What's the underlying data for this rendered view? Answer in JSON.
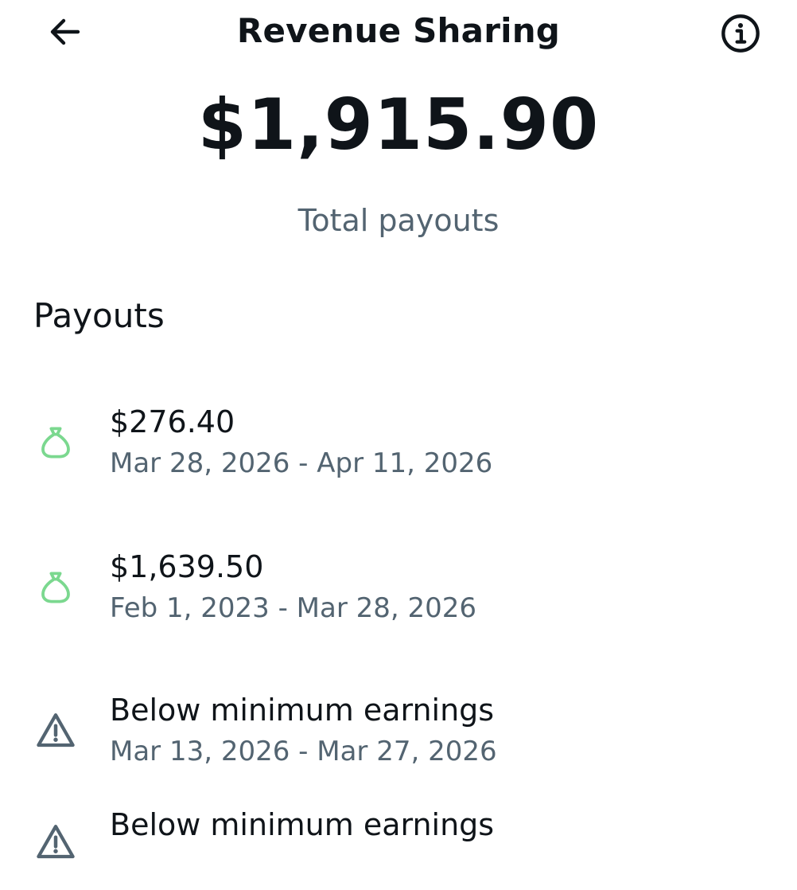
{
  "header": {
    "title": "Revenue Sharing",
    "back_icon": "arrow-left-icon",
    "info_icon": "info-icon"
  },
  "summary": {
    "amount": "$1,915.90",
    "label": "Total payouts"
  },
  "payouts": {
    "heading": "Payouts",
    "items": [
      {
        "title": "$276.40",
        "dates": "Mar 28, 2026 - Apr 11, 2026",
        "icon": "money-bag-icon",
        "icon_color": "#7bd88f"
      },
      {
        "title": "$1,639.50",
        "dates": "Feb 1, 2023 - Mar 28, 2026",
        "icon": "money-bag-icon",
        "icon_color": "#7bd88f"
      },
      {
        "title": "Below minimum earnings",
        "dates": "Mar 13, 2026 - Mar 27, 2026",
        "icon": "warning-icon",
        "icon_color": "#536471"
      },
      {
        "title": "Below minimum earnings",
        "dates": "",
        "icon": "warning-icon",
        "icon_color": "#536471"
      }
    ]
  },
  "colors": {
    "text_primary": "#0f1419",
    "text_secondary": "#536471",
    "accent_green": "#7bd88f"
  }
}
